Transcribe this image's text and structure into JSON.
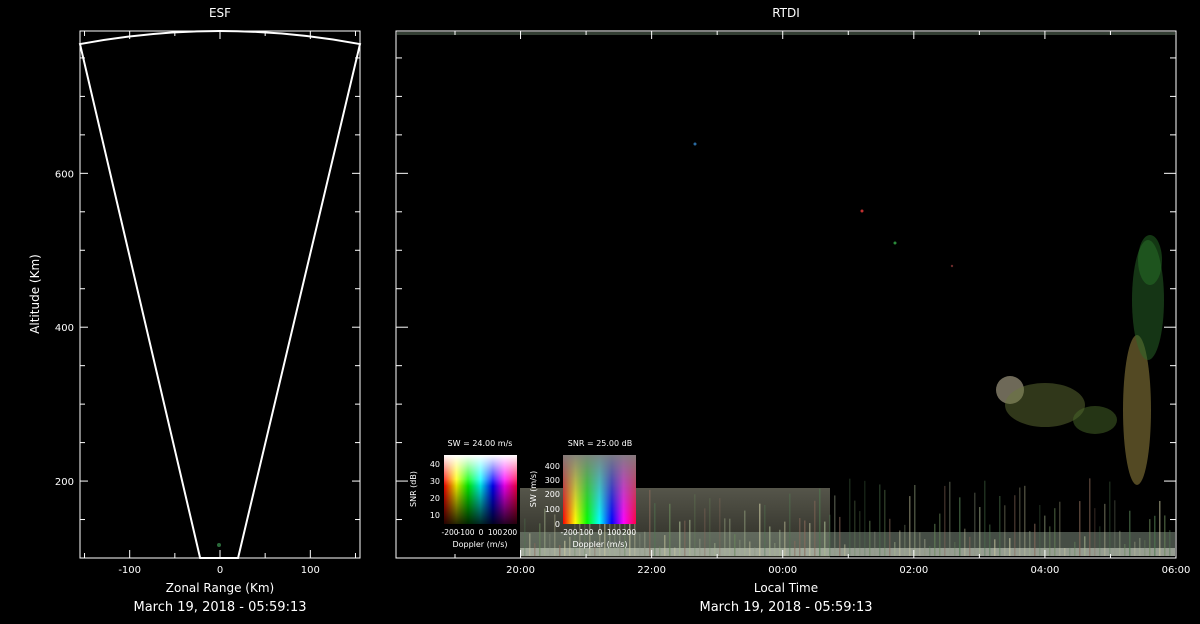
{
  "chart_data": [
    {
      "type": "scatter",
      "title": "ESF",
      "xlabel": "Zonal Range (Km)",
      "ylabel": "Altitude (Km)",
      "xlim": [
        -155,
        155
      ],
      "ylim": [
        100,
        785
      ],
      "x_ticks": [
        -100,
        0,
        100
      ],
      "y_ticks": [
        200,
        400,
        600
      ],
      "x_tick_labels": [
        "-100",
        "0",
        "100"
      ],
      "y_tick_labels": [
        "200",
        "400",
        "600"
      ],
      "fan_outline": {
        "bottom_left_x": -22,
        "bottom_right_x": 20,
        "bottom_y": 100,
        "top_left_x": -155,
        "top_right_x": 155,
        "top_y": 768,
        "arc_peak_y": 785
      },
      "timestamp": "March 19, 2018 - 05:59:13"
    },
    {
      "type": "heatmap",
      "title": "RTDI",
      "xlabel": "Local Time",
      "ylabel": "",
      "x_tick_labels": [
        "20:00",
        "22:00",
        "00:00",
        "02:00",
        "04:00",
        "06:00"
      ],
      "x_ticks_hours": [
        20,
        22,
        24,
        26,
        28,
        30
      ],
      "xlim_hours": [
        18.1,
        30
      ],
      "ylim": [
        100,
        785
      ],
      "y_ticks": [
        200,
        400,
        600
      ],
      "timestamp": "March 19, 2018 - 05:59:13",
      "legends": [
        {
          "title": "SW = 24.00 m/s",
          "xlabel": "Doppler (m/s)",
          "ylabel": "SNR (dB)",
          "x_tick_labels": [
            "-200",
            "-100",
            "0",
            "100",
            "200"
          ],
          "y_tick_labels": [
            "10",
            "20",
            "30",
            "40"
          ]
        },
        {
          "title": "SNR = 25.00 dB",
          "xlabel": "Doppler (m/s)",
          "ylabel": "SW (m/s)",
          "x_tick_labels": [
            "-200",
            "-100",
            "0",
            "100",
            "200"
          ],
          "y_tick_labels": [
            "0",
            "100",
            "200",
            "300",
            "400"
          ]
        }
      ]
    }
  ]
}
